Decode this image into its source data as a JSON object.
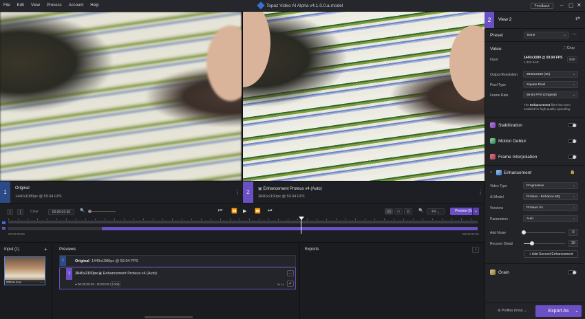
{
  "menu": [
    "File",
    "Edit",
    "View",
    "Process",
    "Account",
    "Help"
  ],
  "app_title": "Topaz Video AI Alpha  v4.1.0.0.a.model",
  "feedback_label": "Feedback",
  "views": {
    "left": {
      "num": "1",
      "title": "Original",
      "sub": "1440x1080px @ 59.94 FPS"
    },
    "right": {
      "num": "2",
      "title": "Enhancement Proteus v4 (Auto)",
      "sub": "3840x2160px @ 59.94 FPS"
    }
  },
  "transport": {
    "in": "[",
    "out": "]",
    "clear": "Clear",
    "timecode": "00:00:01:30",
    "start_time": "00:00:00:00",
    "end_time": "00:00:02:26",
    "fit": "Fit",
    "preview": "Preview (5s)"
  },
  "input": {
    "title": "Input (1)",
    "file": "00016.mov"
  },
  "previews": {
    "title": "Previews",
    "rows": [
      {
        "num": "1",
        "res": "Original",
        "info": "1440x1080px @ 59.94 FPS"
      },
      {
        "num": "2",
        "res": "3840x2160px",
        "info": "Enhancement Proteus v4 (Auto)",
        "range": "00:00:00:29 - 00:00:02:26",
        "loop": "Loop",
        "fps": "5s 1x"
      }
    ]
  },
  "exports": {
    "title": "Exports"
  },
  "sidebar": {
    "view_num": "2",
    "view_title": "View 2",
    "preset_label": "Preset",
    "preset_value": "None",
    "video_title": "Video",
    "crop": "Crop",
    "input_label": "Input",
    "input_value": "1440x1080 @ 59.94 FPS",
    "input_sar": "1.333 SAR",
    "edit": "Edit",
    "output_res_label": "Output Resolution",
    "output_res_value": "3840x2160 (4K)",
    "pixel_type_label": "Pixel Type",
    "pixel_type_value": "Square Pixel",
    "frame_rate_label": "Frame Rate",
    "frame_rate_value": "59.94 FPS (Original)",
    "note_pre": "The ",
    "note_bold": "Enhancement",
    "note_post": " filter has been enabled for high-quality upscaling.",
    "stabilization": "Stabilization",
    "motion_deblur": "Motion Deblur",
    "frame_interpolation": "Frame Interpolation",
    "enhancement": "Enhancement",
    "video_type_label": "Video Type",
    "video_type_value": "Progressive",
    "ai_model_label": "AI Model",
    "ai_model_value": "Proteus - Enhance MQ",
    "versions_label": "Versions",
    "versions_value": "Proteus V4",
    "parameters_label": "Parameters",
    "parameters_value": "Auto",
    "add_noise_label": "Add Noise",
    "add_noise_value": "0",
    "add_noise_level": 0,
    "recover_detail_label": "Recover Detail",
    "recover_detail_value": "20",
    "recover_detail_level": 0.2,
    "add_second": "Add Second Enhancement",
    "grain": "Grain",
    "profiles": "Profiles (mov)",
    "export_as": "Export As"
  }
}
